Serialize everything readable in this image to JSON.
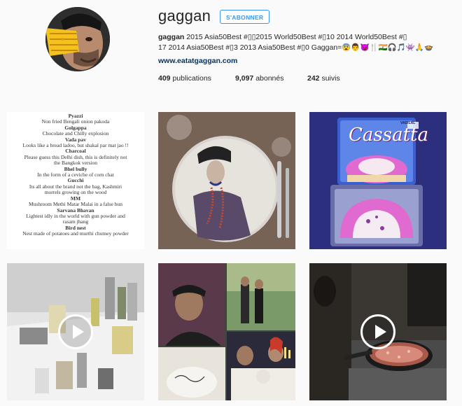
{
  "profile": {
    "username": "gaggan",
    "follow_label": "S'ABONNER",
    "bio_name": "gaggan",
    "bio_line1": " 2015 Asia50Best #▯▯2015 World50Best #▯10 2014 World50Best #▯",
    "bio_line2": "17 2014 Asia50Best #▯3 2013 Asia50Best #▯0 Gaggan=😨👨👿🍴🇮🇳🎧🎵👾🙏🍲",
    "website": "www.eatatgaggan.com",
    "stats": {
      "publications_count": "409",
      "publications_label": "publications",
      "followers_count": "9,097",
      "followers_label": "abonnés",
      "following_count": "242",
      "following_label": "suivis"
    }
  },
  "posts": {
    "menu_lines": [
      {
        "t": "Pyazzi",
        "b": true
      },
      {
        "t": "Non fried Bengali onion pakoda",
        "b": false
      },
      {
        "t": "Golgappa",
        "b": true
      },
      {
        "t": "Chocolate and Chilly explosion",
        "b": false
      },
      {
        "t": "Vada pav",
        "b": true
      },
      {
        "t": "Looks like a bread ladoo, but shakal par mat jao !!",
        "b": false
      },
      {
        "t": "Charcoal",
        "b": true
      },
      {
        "t": "Please guess this Delhi dish, this is definitely not",
        "b": false
      },
      {
        "t": "the Bangkok version",
        "b": false
      },
      {
        "t": "Bhel bully",
        "b": true
      },
      {
        "t": "In the form of a ceviche of corn chat",
        "b": false
      },
      {
        "t": "Gucchi",
        "b": true
      },
      {
        "t": "Its all about the brand not the bag, Kashmiri",
        "b": false
      },
      {
        "t": "morrels growing on the wood",
        "b": false
      },
      {
        "t": "MM",
        "b": true
      },
      {
        "t": "Mushroom Methi Matar Malai in a false bun",
        "b": false
      },
      {
        "t": "Sarvana Bhavan",
        "b": true
      },
      {
        "t": "Lightest idly in the world with gun powder and",
        "b": false
      },
      {
        "t": "rasam jhang",
        "b": false
      },
      {
        "t": "Bird nest",
        "b": true
      },
      {
        "t": "Nest made of potatoes and murthi chutney powder",
        "b": false
      }
    ],
    "cassata_label": "Cassatta",
    "cassata_brand": "VADILAL"
  }
}
